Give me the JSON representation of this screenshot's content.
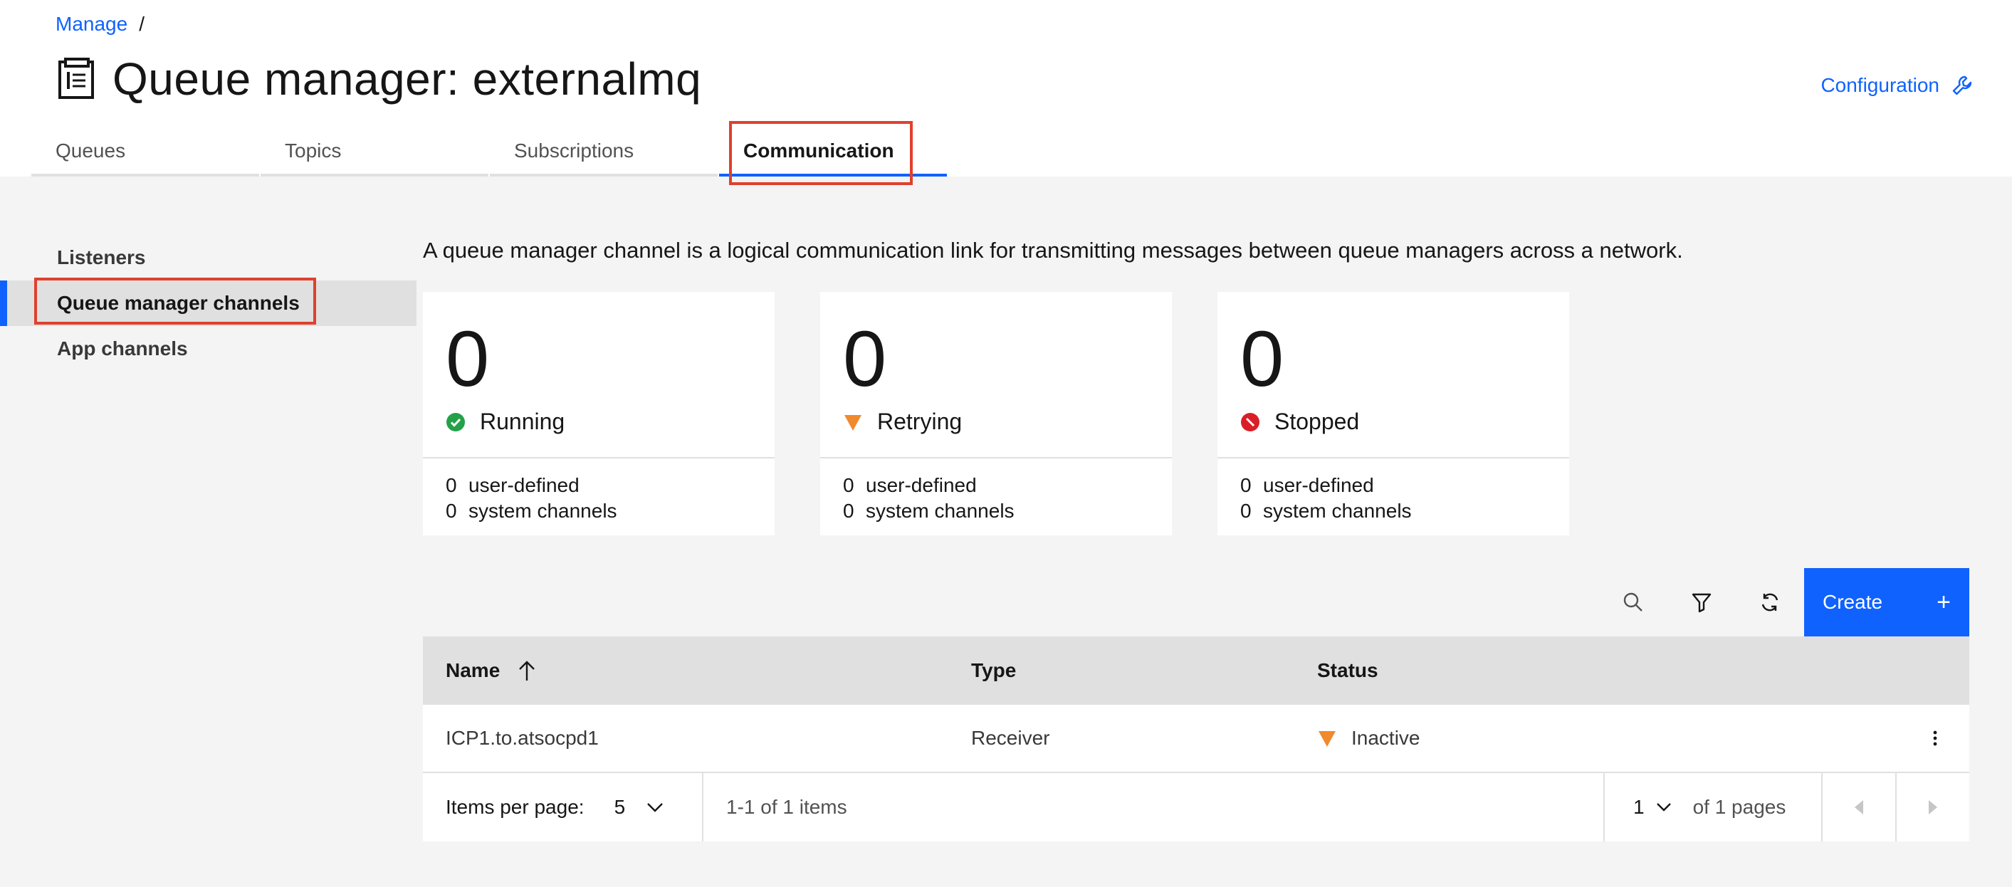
{
  "breadcrumb": {
    "link": "Manage",
    "separator": "/"
  },
  "header": {
    "title": "Queue manager: externalmq",
    "config_label": "Configuration"
  },
  "tabs": [
    {
      "label": "Queues"
    },
    {
      "label": "Topics"
    },
    {
      "label": "Subscriptions"
    },
    {
      "label": "Communication",
      "active": true
    }
  ],
  "sidebar": {
    "items": [
      {
        "label": "Listeners"
      },
      {
        "label": "Queue manager channels",
        "active": true
      },
      {
        "label": "App channels"
      }
    ]
  },
  "main": {
    "description": "A queue manager channel is a logical communication link for transmitting messages between queue managers across a network."
  },
  "cards": [
    {
      "count": "0",
      "status": "Running",
      "user_count": "0",
      "user_label": "user-defined",
      "system_count": "0",
      "system_label": "system channels",
      "color": "#24a148"
    },
    {
      "count": "0",
      "status": "Retrying",
      "user_count": "0",
      "user_label": "user-defined",
      "system_count": "0",
      "system_label": "system channels",
      "color": "#f1892d"
    },
    {
      "count": "0",
      "status": "Stopped",
      "user_count": "0",
      "user_label": "user-defined",
      "system_count": "0",
      "system_label": "system channels",
      "color": "#da1e28"
    }
  ],
  "toolbar": {
    "create_label": "Create",
    "create_plus": "+"
  },
  "table": {
    "headers": {
      "name": "Name",
      "type": "Type",
      "status": "Status"
    },
    "rows": [
      {
        "name": "ICP1.to.atsocpd1",
        "type": "Receiver",
        "status": "Inactive"
      }
    ]
  },
  "pagination": {
    "items_per_page_label": "Items per page:",
    "items_per_page": "5",
    "range": "1-1 of 1 items",
    "page": "1",
    "of_pages": "of 1 pages"
  },
  "colors": {
    "accent": "#0f62fe",
    "highlight": "#e0402e"
  }
}
